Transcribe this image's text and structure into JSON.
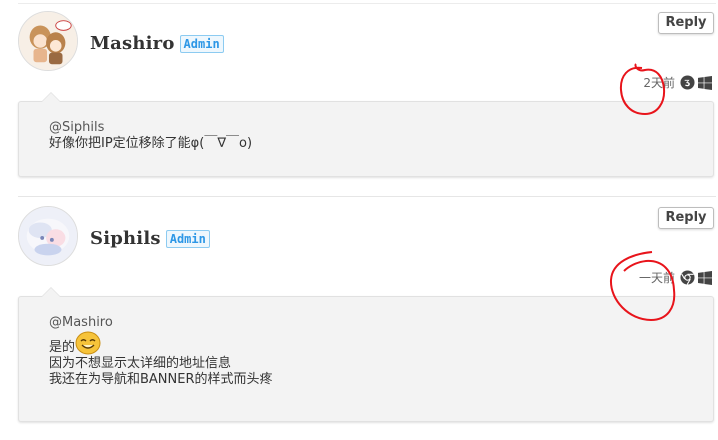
{
  "comments": [
    {
      "author": "Mashiro",
      "badge": "Admin",
      "reply_label": "Reply",
      "time": "2天前",
      "browser_icon": "firefox-icon",
      "os_icon": "windows-icon",
      "mention": "@Siphils",
      "lines": [
        "好像你把IP定位移除了能φ(￣∇￣o)"
      ]
    },
    {
      "author": "Siphils",
      "badge": "Admin",
      "reply_label": "Reply",
      "time": "一天前",
      "browser_icon": "chrome-icon",
      "os_icon": "windows-icon",
      "mention": "@Mashiro",
      "lines": [
        "是的",
        "因为不想显示太详细的地址信息",
        "我还在为导航和BANNER的样式而头疼"
      ]
    }
  ],
  "colors": {
    "admin_badge": "#2d97e6",
    "annotation": "#e8141b",
    "bubble": "#f3f3f3"
  }
}
